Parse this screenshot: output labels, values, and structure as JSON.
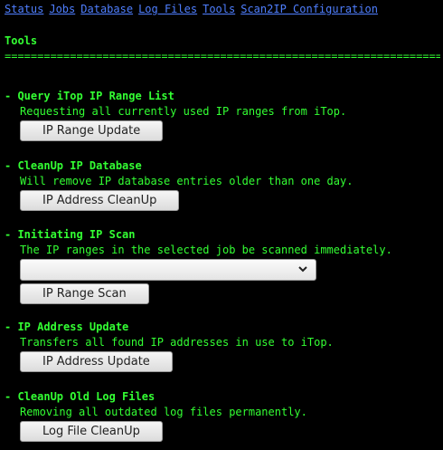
{
  "nav": {
    "items": [
      "Status",
      "Jobs",
      "Database",
      "Log Files",
      "Tools",
      "Scan2IP Configuration"
    ]
  },
  "page": {
    "title": "Tools",
    "rule": "================================================================================================"
  },
  "sections": [
    {
      "heading": "-  Query iTop IP Range List",
      "description": "Requesting all currently used IP ranges from iTop.",
      "button": "IP Range Update"
    },
    {
      "heading": "-  CleanUp IP Database",
      "description": "Will remove IP database entries older than one day.",
      "button": "IP Address CleanUp"
    },
    {
      "heading": "-  Initiating IP Scan",
      "description": "The IP ranges in the selected job be scanned immediately.",
      "select_value": "",
      "button": "IP Range Scan"
    },
    {
      "heading": "-  IP Address Update",
      "description": "Transfers all found IP addresses in use to iTop.",
      "button": "IP Address Update"
    },
    {
      "heading": "-  CleanUp Old Log Files",
      "description": "Removing all outdated log files permanently.",
      "button": "Log File CleanUp"
    }
  ],
  "icons": {
    "select_chevron": "chevron-down-icon"
  },
  "colors": {
    "background": "#000000",
    "text": "#33ff33",
    "link": "#4f7fff",
    "button_text": "#222222"
  }
}
